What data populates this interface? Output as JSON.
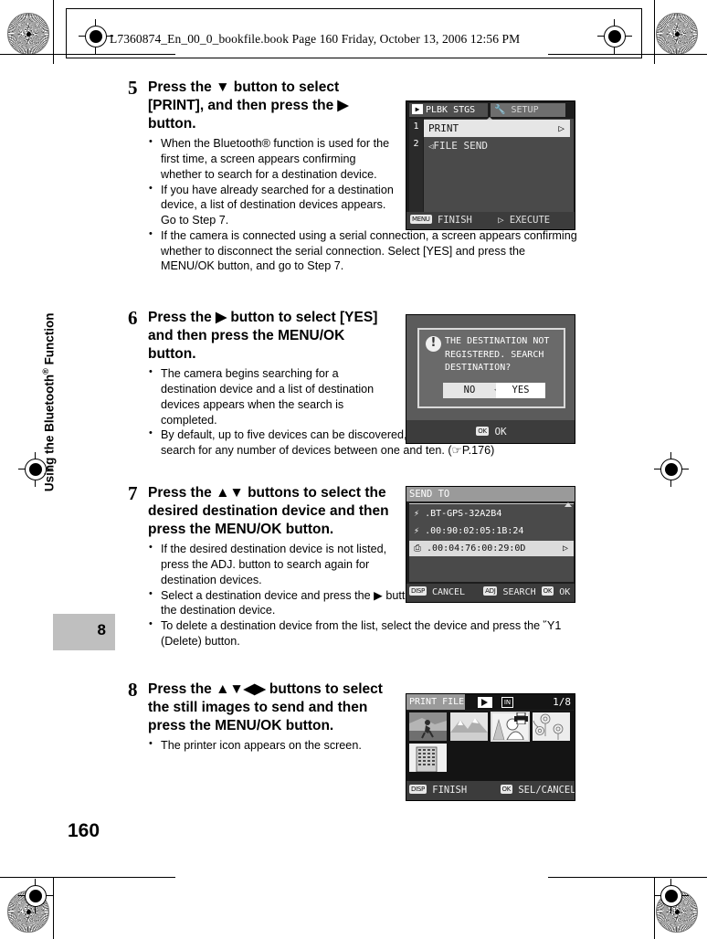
{
  "header": {
    "book_line": "L7360874_En_00_0_bookfile.book  Page 160  Friday, October 13, 2006  12:56 PM"
  },
  "sidebar": {
    "chapter_title": "Using the Bluetooth",
    "chapter_title_suffix": " Function",
    "registered_mark": "®",
    "chapter_number": "8",
    "page_number": "160"
  },
  "steps": [
    {
      "number": "5",
      "heading": "Press the ▼ button to select [PRINT], and then press the ▶ button.",
      "notes": [
        "When the Bluetooth® function is used for the first time, a screen appears confirming whether to search for a destination device.",
        "If you have already searched for a destination device, a list of destination devices appears. Go to Step 7.",
        "If the camera is connected using a serial connection, a screen appears confirming whether to disconnect the serial connection. Select [YES] and press the MENU/OK button, and go to Step 7."
      ]
    },
    {
      "number": "6",
      "heading": "Press the ▶ button to select [YES] and then press the MENU/OK button.",
      "notes": [
        "The camera begins searching for a destination device and a list of destination devices appears when the search is completed.",
        "By default, up to five devices can be discovered, but you can change this to search for any number of devices between one and ten. (☞P.176)"
      ]
    },
    {
      "number": "7",
      "heading": "Press the ▲▼ buttons to select the desired destination device and then press the MENU/OK button.",
      "notes": [
        "If the desired destination device is not listed, press the ADJ. button to search again for destination devices.",
        "Select a destination device and press the ▶ button to display information about the destination device.",
        "To delete a destination device from the list, select the device and press the Ὕ1 (Delete) button."
      ]
    },
    {
      "number": "8",
      "heading": "Press the ▲▼◀▶ buttons to select the still images to send and then press the MENU/OK button.",
      "notes": [
        "The printer icon appears on the screen."
      ]
    }
  ],
  "screens": {
    "playback_settings": {
      "tab_active": "PLBK STGS",
      "tab_inactive": "SETUP",
      "rows": [
        {
          "index": "1",
          "label": "PRINT",
          "marker": "▷",
          "selected": true
        },
        {
          "index": "2",
          "label": "FILE SEND",
          "marker": "◁",
          "selected": false
        }
      ],
      "footer_left_key": "MENU",
      "footer_left_label": "FINISH",
      "footer_right_key": "▷",
      "footer_right_label": "EXECUTE"
    },
    "confirm_dialog": {
      "icon": "!",
      "message": "THE DESTINATION NOT REGISTERED. SEARCH DESTINATION?",
      "button_no": "NO",
      "button_yes": "YES",
      "footer_key": "OK",
      "footer_label": "OK"
    },
    "send_to": {
      "title": "SEND TO",
      "items": [
        {
          "icon": "⚡",
          "label": ".BT-GPS-32A2B4",
          "selected": false
        },
        {
          "icon": "⚡",
          "label": ".00:90:02:05:1B:24",
          "selected": false
        },
        {
          "icon": "⎙",
          "label": ".00:04:76:00:29:0D",
          "selected": true,
          "marker": "▷"
        }
      ],
      "footer_key_left": "DISP",
      "footer_left": "CANCEL",
      "footer_key_mid": "ADJ",
      "footer_mid": "SEARCH",
      "footer_key_right": "OK",
      "footer_right": "OK"
    },
    "print_file": {
      "title": "PRINT FILE",
      "mode_icon": "play",
      "memory_icon": "IN",
      "counter": "1/8",
      "thumbnails": [
        {
          "scene": "runner",
          "selected": false
        },
        {
          "scene": "mountains",
          "selected": false
        },
        {
          "scene": "portrait",
          "selected": true,
          "badge": "printer"
        },
        {
          "scene": "flowers",
          "selected": false
        },
        {
          "scene": "building",
          "selected": false
        }
      ],
      "footer_key_left": "DISP",
      "footer_left": "FINISH",
      "footer_key_right": "OK",
      "footer_right": "SEL/CANCEL"
    }
  }
}
